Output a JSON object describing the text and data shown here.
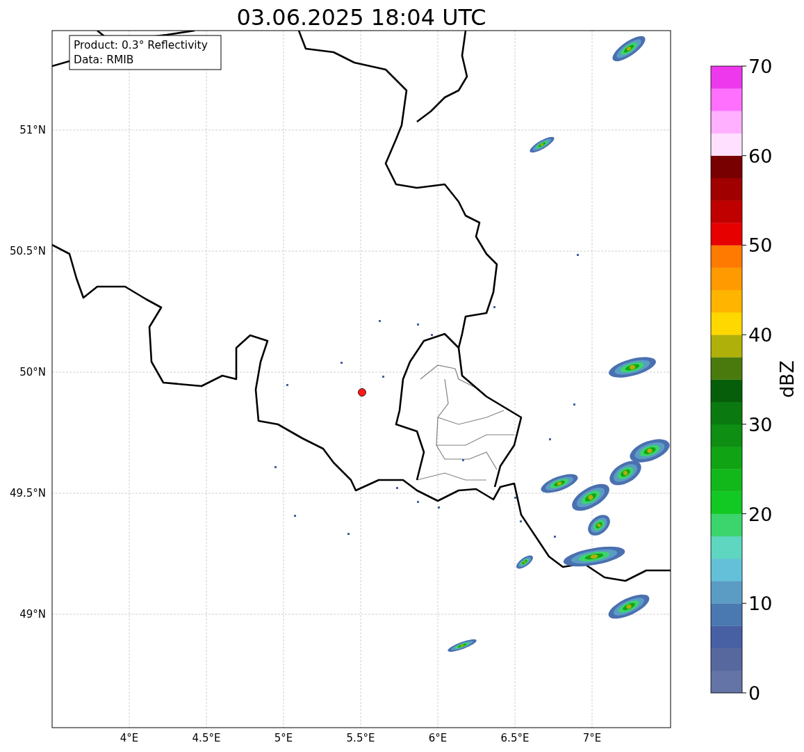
{
  "title": "03.06.2025 18:04 UTC",
  "info_box": {
    "lines": [
      "Product: 0.3° Reflectivity",
      "Data: RMIB"
    ]
  },
  "map": {
    "lat_ticks": [
      "51°N",
      "50.5°N",
      "50°N",
      "49.5°N",
      "49°N"
    ],
    "lon_ticks": [
      "4°E",
      "4.5°E",
      "5°E",
      "5.5°E",
      "6°E",
      "6.5°E",
      "7°E"
    ]
  },
  "colorbar": {
    "label": "dBZ",
    "ticks": [
      "70",
      "60",
      "50",
      "40",
      "30",
      "20",
      "10",
      "0"
    ],
    "bands": [
      {
        "color": "#6474a6"
      },
      {
        "color": "#56689e"
      },
      {
        "color": "#4760a4"
      },
      {
        "color": "#4a78b0"
      },
      {
        "color": "#5b9cc4"
      },
      {
        "color": "#64c0d8"
      },
      {
        "color": "#5ed6c0"
      },
      {
        "color": "#3cd46c"
      },
      {
        "color": "#12c822"
      },
      {
        "color": "#12b81a"
      },
      {
        "color": "#10a414"
      },
      {
        "color": "#0e8e12"
      },
      {
        "color": "#0a7a10"
      },
      {
        "color": "#075e0a"
      },
      {
        "color": "#4a7a0e"
      },
      {
        "color": "#b0b00a"
      },
      {
        "color": "#ffd800"
      },
      {
        "color": "#ffb400"
      },
      {
        "color": "#ff9a00"
      },
      {
        "color": "#ff7a00"
      },
      {
        "color": "#e60000"
      },
      {
        "color": "#c00000"
      },
      {
        "color": "#a00000"
      },
      {
        "color": "#780000"
      },
      {
        "color": "#ffe0ff"
      },
      {
        "color": "#ffb0ff"
      },
      {
        "color": "#ff70ff"
      },
      {
        "color": "#ee38ee"
      }
    ]
  }
}
